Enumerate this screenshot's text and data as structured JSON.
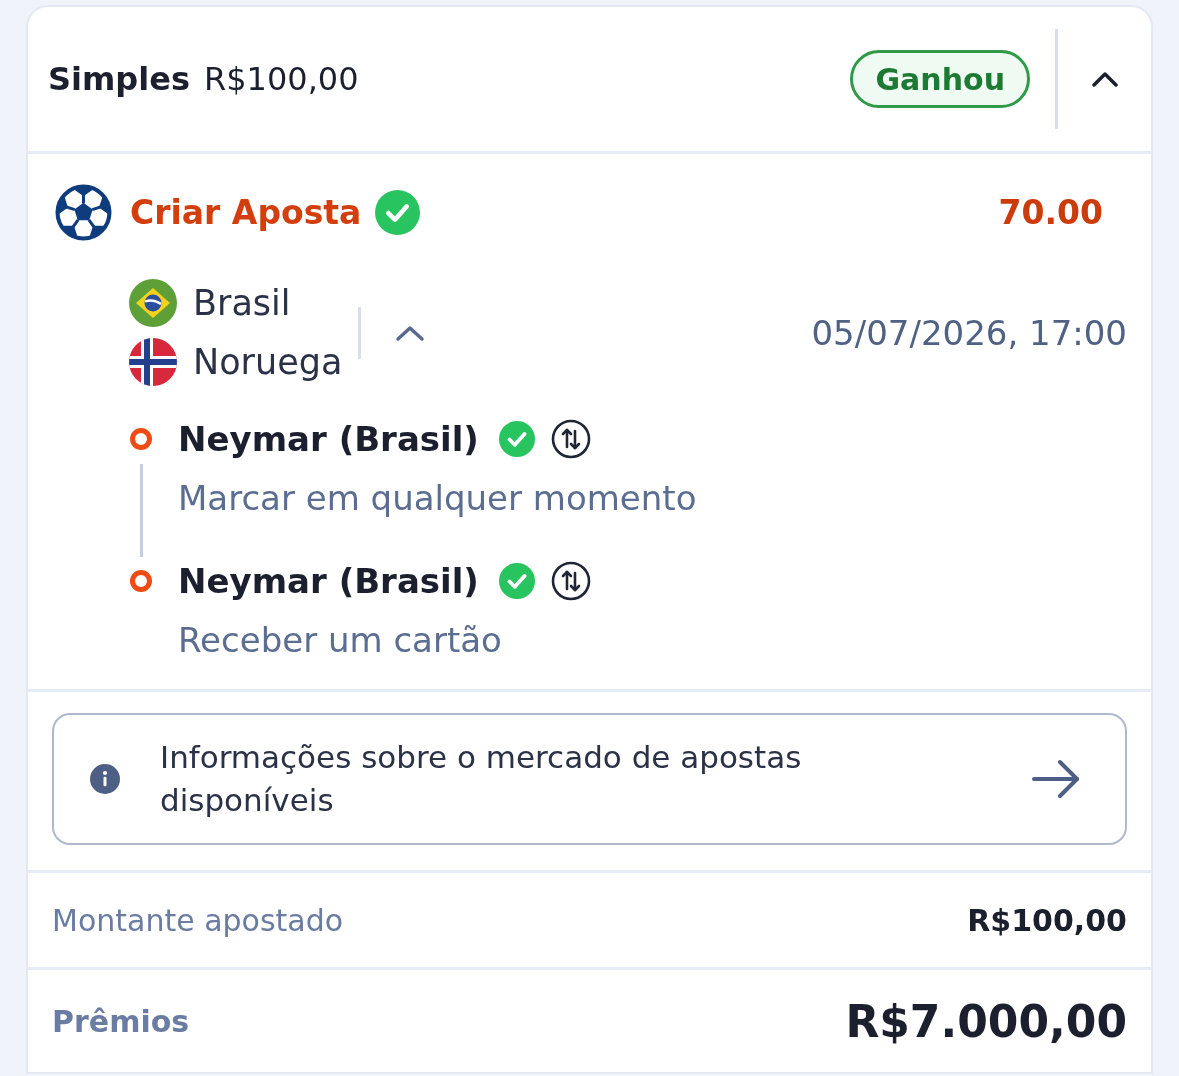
{
  "bet": {
    "type": "Simples",
    "stake": "R$100,00",
    "status": {
      "label": "Ganhou",
      "kind": "won"
    },
    "expanded": true
  },
  "selection": {
    "title": "Criar Aposta",
    "won": true,
    "odds": "70.00"
  },
  "event": {
    "teams": [
      {
        "name": "Brasil"
      },
      {
        "name": "Noruega"
      }
    ],
    "expanded": true,
    "datetime": "05/07/2026, 17:00"
  },
  "legs": [
    {
      "player": "Neymar (Brasil)",
      "won": true,
      "market": "Marcar em qualquer momento"
    },
    {
      "player": "Neymar (Brasil)",
      "won": true,
      "market": "Receber um cartão"
    }
  ],
  "info": {
    "text": "Informações sobre o mercado de apostas disponíveis"
  },
  "summary": [
    {
      "kind": "stake",
      "label": "Montante apostado",
      "value": "R$100,00"
    },
    {
      "kind": "payout",
      "label": "Prêmios",
      "value": "R$7.000,00"
    }
  ]
}
